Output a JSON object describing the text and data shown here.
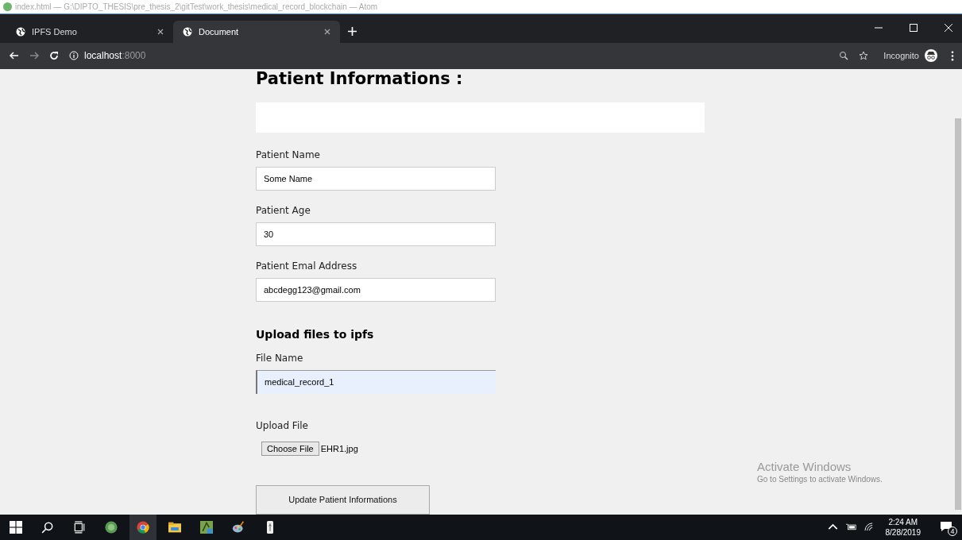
{
  "background_window": {
    "title": "index.html — G:\\DIPTO_THESIS\\pre_thesis_2\\gitTest\\work_thesis\\medical_record_blockchain — Atom"
  },
  "tabs": [
    {
      "label": "IPFS Demo",
      "selected": false
    },
    {
      "label": "Document",
      "selected": true
    }
  ],
  "address_bar": {
    "host": "localhost",
    "port": ":8000"
  },
  "profile": {
    "label": "Incognito"
  },
  "page": {
    "heading": "Patient Informations :",
    "patient_fields": [
      {
        "label": "Patient Name",
        "value": "Some Name",
        "focused": false
      },
      {
        "label": "Patient Age",
        "value": "30",
        "focused": false
      },
      {
        "label": "Patient Emal Address",
        "value": "abcdegg123@gmail.com",
        "focused": false
      }
    ],
    "upload_heading": "Upload files to ipfs",
    "file_fields": [
      {
        "label": "File Name",
        "value": "medical_record_1",
        "focused": true
      }
    ],
    "upload_label": "Upload File",
    "choose_button": "Choose File",
    "chosen_file": "EHR1.jpg",
    "submit_button": "Update Patient Informations"
  },
  "activation_notice": {
    "title": "Activate Windows",
    "subtitle": "Go to Settings to activate Windows."
  },
  "taskbar": {
    "time": "2:24 AM",
    "date": "8/28/2019",
    "notifications": "4"
  }
}
